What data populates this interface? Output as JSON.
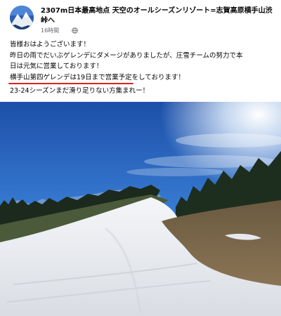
{
  "post": {
    "page_name": "2307m日本最高地点 天空のオールシーズンリゾート=志賀高原横手山渋峠へ",
    "timestamp": "16時間",
    "privacy_icon": "globe-icon",
    "avatar_icon": "mountain-avatar",
    "text": {
      "line1": "皆様おはようございます！",
      "line2": "昨日の雨でだいぶゲレンデにダメージがありましたが、圧雪チームの努力で本",
      "line3": "日は元気に営業しております！",
      "line4_highlight": "横手山第四ゲレンデは19日まで営業予定",
      "line4_rest": "をしております！",
      "line5": "23-24シーズンまだ滑り足りない方集まれー！"
    },
    "photo": {
      "subject": "ski-slope-photo"
    }
  },
  "colors": {
    "underline": "#e02020",
    "sky": "#2f6fc9",
    "snow": "#eef2f6"
  }
}
